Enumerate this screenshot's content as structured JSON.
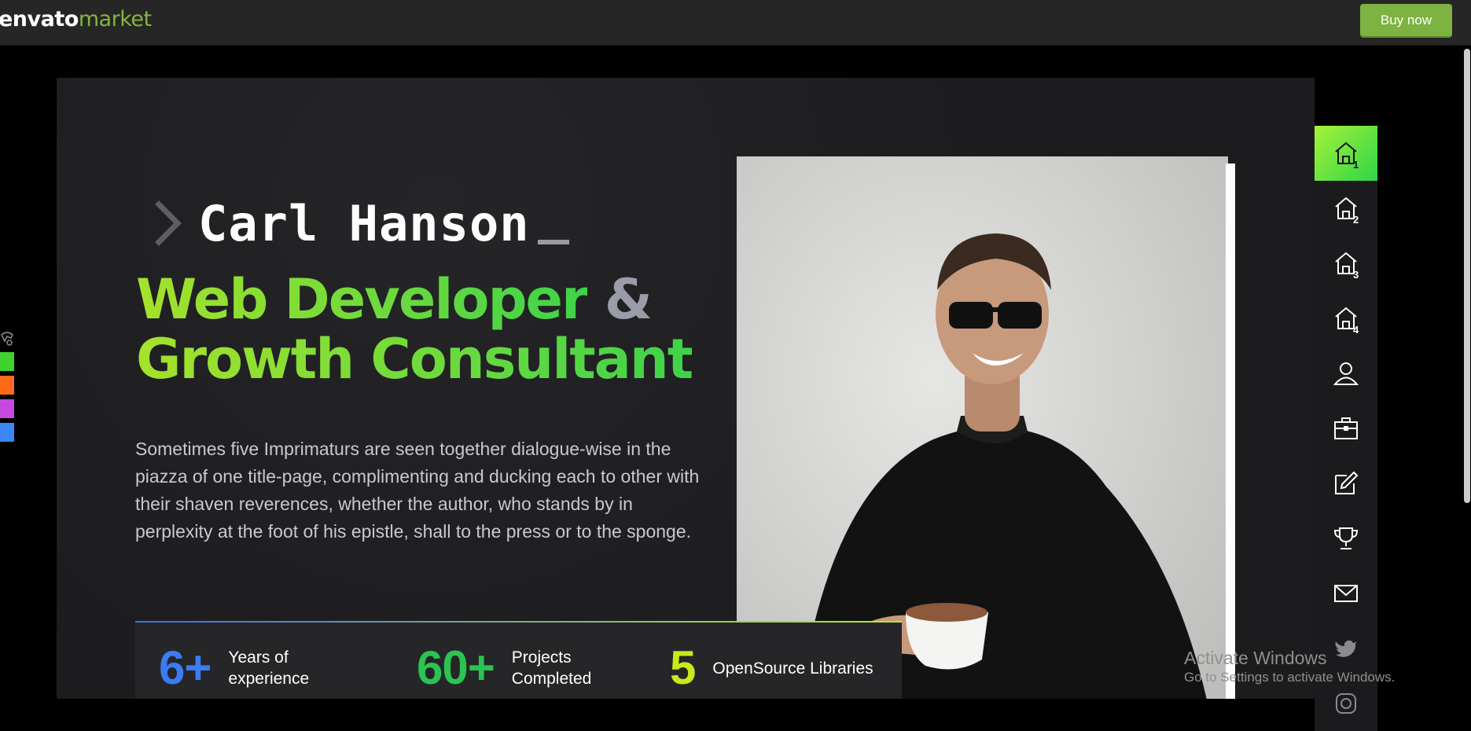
{
  "topbar": {
    "logo_part1": "envato",
    "logo_part2": "market",
    "buy_label": "Buy now"
  },
  "hero": {
    "name": "Carl Hanson",
    "headline_line1": "Web Developer",
    "headline_amp": "&",
    "headline_line2": "Growth Consultant",
    "description": "Sometimes five Imprimaturs are seen together dialogue-wise in the piazza of one title-page, complimenting and ducking each to other with their shaven reverences, whether the author, who stands by in perplexity at the foot of his epistle, shall to the press or to the sponge."
  },
  "stats": [
    {
      "value": "6+",
      "label": "Years of experience",
      "color": "#3b7cf2"
    },
    {
      "value": "60+",
      "label": "Projects Completed",
      "color": "#2ac452"
    },
    {
      "value": "5",
      "label": "OpenSource Libraries",
      "color": "#c8ea1c"
    }
  ],
  "sidenav": {
    "items": [
      {
        "icon": "home-icon",
        "num": "1",
        "active": true
      },
      {
        "icon": "home-icon",
        "num": "2"
      },
      {
        "icon": "home-icon",
        "num": "3"
      },
      {
        "icon": "home-icon",
        "num": "4"
      },
      {
        "icon": "user-icon"
      },
      {
        "icon": "briefcase-icon"
      },
      {
        "icon": "edit-icon"
      },
      {
        "icon": "trophy-icon"
      },
      {
        "icon": "mail-icon"
      },
      {
        "icon": "twitter-icon"
      },
      {
        "icon": "instagram-icon"
      }
    ]
  },
  "swatches": [
    "#3fd12d",
    "#ff6a1a",
    "#c649e0",
    "#3a87f5"
  ],
  "watermark": {
    "title": "Activate Windows",
    "subtitle": "Go to Settings to activate Windows."
  },
  "colors": {
    "accent_green": "#82b541",
    "bg": "#1e1e20"
  }
}
